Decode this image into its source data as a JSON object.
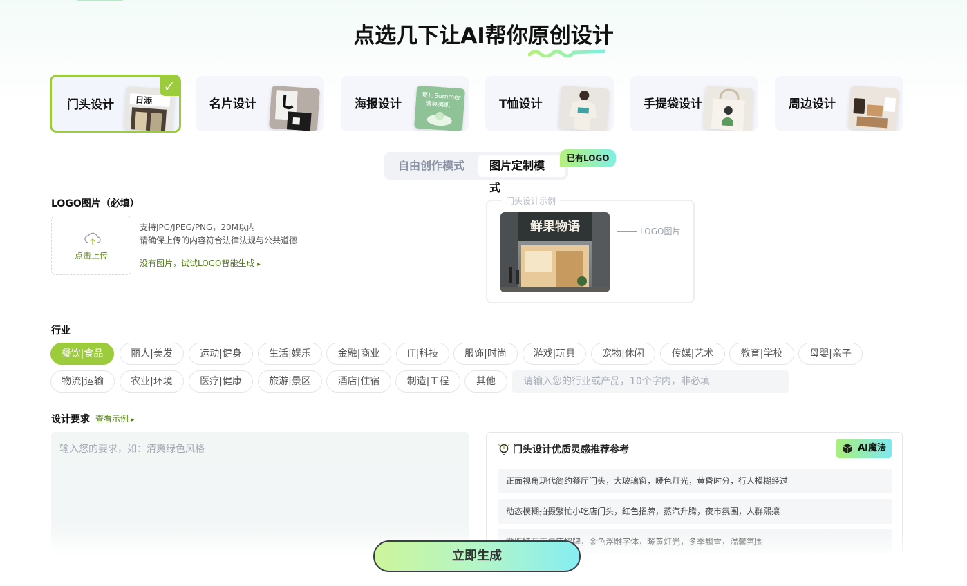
{
  "headline": {
    "prefix": "点选几下让AI帮你",
    "highlight": "原创设计"
  },
  "categories": [
    {
      "label": "门头设计",
      "active": true
    },
    {
      "label": "名片设计",
      "active": false
    },
    {
      "label": "海报设计",
      "active": false
    },
    {
      "label": "T恤设计",
      "active": false
    },
    {
      "label": "手提袋设计",
      "active": false
    },
    {
      "label": "周边设计",
      "active": false
    }
  ],
  "mode": {
    "free": "自由创作模式",
    "image": "图片定制模式",
    "badge": "已有LOGO"
  },
  "logo_section": {
    "title": "LOGO图片（必填）",
    "upload_label": "点击上传",
    "hint_line1": "支持JPG/JPEG/PNG，20M以内",
    "hint_line2": "请确保上传的内容符合法律法规与公共道德",
    "ai_link": "没有图片，试试LOGO智能生成",
    "ai_link_arrow": "▸"
  },
  "example": {
    "title": "门头设计示例",
    "sign_text": "鲜果物语",
    "arrow_label": "LOGO图片"
  },
  "industry": {
    "title": "行业",
    "chips": [
      "餐饮|食品",
      "丽人|美发",
      "运动|健身",
      "生活|娱乐",
      "金融|商业",
      "IT|科技",
      "服饰|时尚",
      "游戏|玩具",
      "宠物|休闲",
      "传媒|艺术",
      "教育|学校",
      "母婴|亲子",
      "物流|运输",
      "农业|环境",
      "医疗|健康",
      "旅游|景区",
      "酒店|住宿",
      "制造|工程",
      "其他"
    ],
    "active_index": 0,
    "input_placeholder": "请输入您的行业或产品，10个字内，非必填"
  },
  "requirements": {
    "title": "设计要求",
    "example_link": "查看示例",
    "example_arrow": "▸",
    "placeholder": "输入您的要求，如：清爽绿色风格"
  },
  "inspiration": {
    "title": "门头设计优质灵感推荐参考",
    "magic_label": "AI魔法",
    "items": [
      "正面视角现代简约餐厅门头，大玻璃窗，暖色灯光，黄昏时分，行人模糊经过",
      "动态模糊拍摄繁忙小吃店门头，红色招牌，蒸汽升腾，夜市氛围，人群熙攘",
      "微距特写面包店招牌，金色浮雕字体，暖黄灯光，冬季飘雪，温馨氛围"
    ]
  },
  "generate_label": "立即生成",
  "colors": {
    "accent": "#9ccb3c",
    "link": "#4e7d12"
  }
}
